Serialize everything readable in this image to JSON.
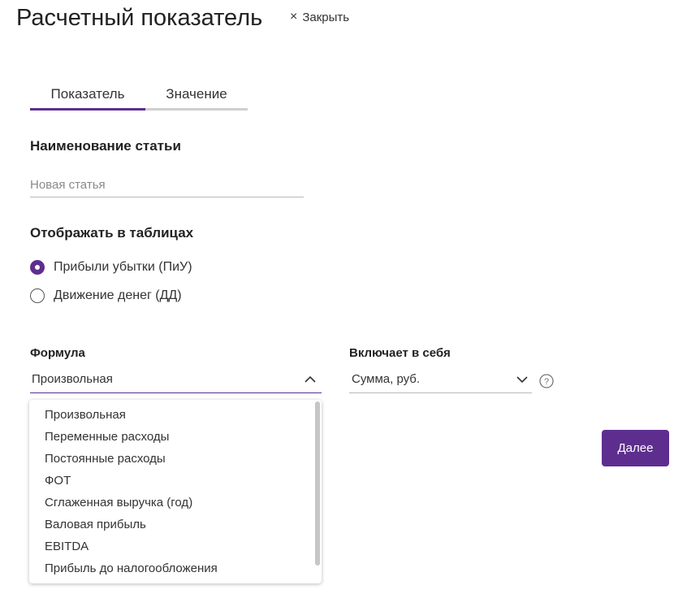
{
  "header": {
    "title": "Расчетный показатель",
    "close_icon": "close-icon",
    "close_label": "Закрыть"
  },
  "tabs": [
    {
      "label": "Показатель",
      "active": true
    },
    {
      "label": "Значение",
      "active": false
    }
  ],
  "article_name": {
    "heading": "Наименование статьи",
    "placeholder": "Новая статья",
    "value": ""
  },
  "display_in_tables": {
    "heading": "Отображать в таблицах",
    "options": [
      {
        "label": "Прибыли убытки (ПиУ)",
        "checked": true
      },
      {
        "label": "Движение денег (ДД)",
        "checked": false
      }
    ]
  },
  "formula": {
    "label": "Формула",
    "selected": "Произвольная",
    "expanded": true,
    "chevron_icon": "chevron-up-icon",
    "options": [
      "Произвольная",
      "Переменные расходы",
      "Постоянные расходы",
      "ФОТ",
      "Сглаженная выручка (год)",
      "Валовая прибыль",
      "EBITDA",
      "Прибыль до налогообложения"
    ]
  },
  "includes": {
    "label": "Включает в себя",
    "selected": "Сумма, руб.",
    "chevron_icon": "chevron-down-icon",
    "help_icon": "help-icon"
  },
  "actions": {
    "next_label": "Далее"
  },
  "colors": {
    "accent": "#5e2e8f",
    "tab_inactive_bar": "#cfcfcf",
    "text": "#222222",
    "placeholder": "#8a8a8a",
    "button_text": "#ffffff"
  }
}
